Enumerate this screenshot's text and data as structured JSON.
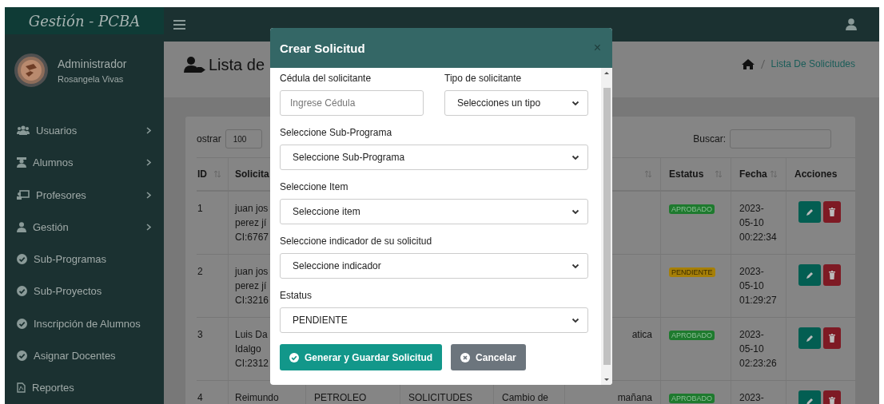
{
  "brand": {
    "title": "Gestión - PCBA"
  },
  "user": {
    "role": "Administrador",
    "name": "Rosangela Vivas"
  },
  "sidebar": {
    "items": [
      {
        "label": "Usuarios",
        "kind": "users",
        "has_submenu": true
      },
      {
        "label": "Alumnos",
        "kind": "student",
        "has_submenu": true
      },
      {
        "label": "Profesores",
        "kind": "chalkboard",
        "has_submenu": true
      },
      {
        "label": "Gestión",
        "kind": "person",
        "has_submenu": true
      },
      {
        "label": "Sub-Programas",
        "kind": "check",
        "has_submenu": false
      },
      {
        "label": "Sub-Proyectos",
        "kind": "check",
        "has_submenu": false
      },
      {
        "label": "Inscripción de Alumnos",
        "kind": "check",
        "has_submenu": false
      },
      {
        "label": "Asignar Docentes",
        "kind": "check",
        "has_submenu": false
      },
      {
        "label": "Reportes",
        "kind": "document",
        "has_submenu": false
      }
    ]
  },
  "page_header": {
    "title": "Lista de",
    "breadcrumb": [
      "Lista De Solicitudes"
    ]
  },
  "table_controls": {
    "length_label": "ostrar",
    "length_value": "100",
    "search_label": "Buscar:"
  },
  "table": {
    "columns": [
      {
        "label": "ID",
        "sortable": true
      },
      {
        "label": "Solicita"
      },
      {},
      {},
      {},
      {
        "sortable": true
      },
      {
        "label": "Estatus",
        "sortable": true
      },
      {
        "label": "Fecha",
        "sortable": true
      },
      {
        "label": "Acciones"
      }
    ],
    "rows": [
      {
        "id": "1",
        "column_2": [
          "juan jos",
          "perez jí",
          "CI:6767"
        ],
        "status": {
          "label": "APROBADO",
          "kind": "approved"
        },
        "date": [
          "2023-",
          "05-10",
          "00:22:34"
        ]
      },
      {
        "id": "2",
        "column_2": [
          "juan jos",
          "perez jí",
          "CI:3216"
        ],
        "status": {
          "label": "PENDIENTE",
          "kind": "pending"
        },
        "date": [
          "2023-",
          "05-10",
          "01:29:27"
        ]
      },
      {
        "id": "3",
        "column_2": [
          "Luis Da",
          "Idalgo",
          "CI:2312"
        ],
        "column_6": [
          "atica"
        ],
        "status": {
          "label": "APROBADO",
          "kind": "approved"
        },
        "date": [
          "2023-",
          "05-10",
          "02:23:26"
        ]
      },
      {
        "id": "4",
        "column_2": [
          "Reimundo"
        ],
        "column_3": [
          "PETROLEO"
        ],
        "column_4": [
          "SOLICITUDES"
        ],
        "column_5": [
          "Cambio de"
        ],
        "column_6": [
          "mañana"
        ],
        "status": {
          "label": "APROBADO",
          "kind": "approved"
        },
        "date": [
          "2023-"
        ]
      }
    ]
  },
  "modal": {
    "title": "Crear Solicitud",
    "close": "×",
    "rows": [
      [
        {
          "kind": "input",
          "label": "Cédula del solicitante",
          "placeholder": "Ingrese Cédula"
        },
        {
          "kind": "select",
          "label": "Tipo de solicitante",
          "value": "Selecciones un tipo"
        }
      ],
      [
        {
          "kind": "select",
          "label": "Seleccione Sub-Programa",
          "value": "Seleccione Sub-Programa"
        }
      ],
      [
        {
          "kind": "select",
          "label": "Seleccione Item",
          "value": "Seleccione item"
        }
      ],
      [
        {
          "kind": "select",
          "label": "Seleccione indicador de su solicitud",
          "value": "Seleccione indicador"
        }
      ],
      [
        {
          "kind": "select",
          "label": "Estatus",
          "value": "PENDIENTE"
        }
      ]
    ],
    "buttons": [
      {
        "label": "Generar y Guardar Solicitud",
        "kind": "primary"
      },
      {
        "label": "Cancelar",
        "kind": "secondary"
      }
    ]
  }
}
